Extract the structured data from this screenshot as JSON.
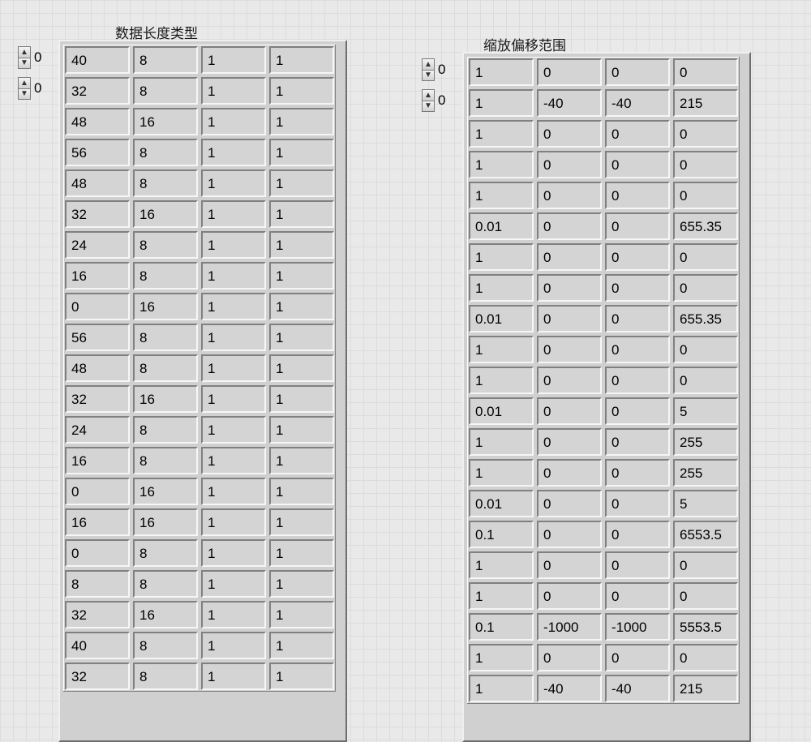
{
  "left": {
    "title": "数据长度类型",
    "index_row": "0",
    "index_col": "0",
    "cols": 4,
    "rows": [
      [
        "40",
        "8",
        "1",
        "1"
      ],
      [
        "32",
        "8",
        "1",
        "1"
      ],
      [
        "48",
        "16",
        "1",
        "1"
      ],
      [
        "56",
        "8",
        "1",
        "1"
      ],
      [
        "48",
        "8",
        "1",
        "1"
      ],
      [
        "32",
        "16",
        "1",
        "1"
      ],
      [
        "24",
        "8",
        "1",
        "1"
      ],
      [
        "16",
        "8",
        "1",
        "1"
      ],
      [
        "0",
        "16",
        "1",
        "1"
      ],
      [
        "56",
        "8",
        "1",
        "1"
      ],
      [
        "48",
        "8",
        "1",
        "1"
      ],
      [
        "32",
        "16",
        "1",
        "1"
      ],
      [
        "24",
        "8",
        "1",
        "1"
      ],
      [
        "16",
        "8",
        "1",
        "1"
      ],
      [
        "0",
        "16",
        "1",
        "1"
      ],
      [
        "16",
        "16",
        "1",
        "1"
      ],
      [
        "0",
        "8",
        "1",
        "1"
      ],
      [
        "8",
        "8",
        "1",
        "1"
      ],
      [
        "32",
        "16",
        "1",
        "1"
      ],
      [
        "40",
        "8",
        "1",
        "1"
      ],
      [
        "32",
        "8",
        "1",
        "1"
      ]
    ]
  },
  "right": {
    "title": "缩放偏移范围",
    "index_row": "0",
    "index_col": "0",
    "cols": 4,
    "rows": [
      [
        "1",
        "0",
        "0",
        "0"
      ],
      [
        "1",
        "-40",
        "-40",
        "215"
      ],
      [
        "1",
        "0",
        "0",
        "0"
      ],
      [
        "1",
        "0",
        "0",
        "0"
      ],
      [
        "1",
        "0",
        "0",
        "0"
      ],
      [
        "0.01",
        "0",
        "0",
        "655.35"
      ],
      [
        "1",
        "0",
        "0",
        "0"
      ],
      [
        "1",
        "0",
        "0",
        "0"
      ],
      [
        "0.01",
        "0",
        "0",
        "655.35"
      ],
      [
        "1",
        "0",
        "0",
        "0"
      ],
      [
        "1",
        "0",
        "0",
        "0"
      ],
      [
        "0.01",
        "0",
        "0",
        "5"
      ],
      [
        "1",
        "0",
        "0",
        "255"
      ],
      [
        "1",
        "0",
        "0",
        "255"
      ],
      [
        "0.01",
        "0",
        "0",
        "5"
      ],
      [
        "0.1",
        "0",
        "0",
        "6553.5"
      ],
      [
        "1",
        "0",
        "0",
        "0"
      ],
      [
        "1",
        "0",
        "0",
        "0"
      ],
      [
        "0.1",
        "-1000",
        "-1000",
        "5553.5"
      ],
      [
        "1",
        "0",
        "0",
        "0"
      ],
      [
        "1",
        "-40",
        "-40",
        "215"
      ]
    ]
  }
}
